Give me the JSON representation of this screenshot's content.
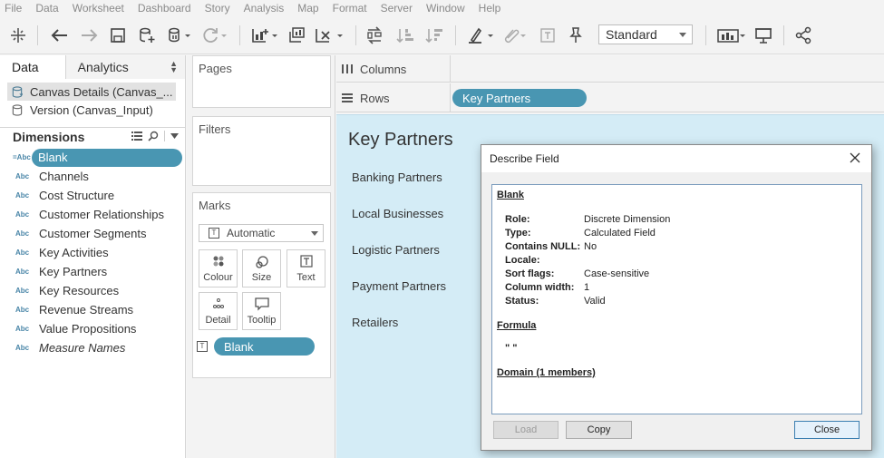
{
  "menu": [
    "File",
    "Data",
    "Worksheet",
    "Dashboard",
    "Story",
    "Analysis",
    "Map",
    "Format",
    "Server",
    "Window",
    "Help"
  ],
  "toolbar": {
    "fit_select": "Standard",
    "icons": [
      "tableau-logo-icon",
      "undo-icon",
      "redo-icon",
      "save-icon",
      "new-datasource-icon",
      "pause-updates-icon",
      "refresh-icon",
      "new-worksheet-icon",
      "duplicate-icon",
      "clear-sheet-icon",
      "swap-icon",
      "sort-ascending-icon",
      "sort-descending-icon",
      "highlight-icon",
      "group-icon",
      "label-icon",
      "pin-icon",
      "show-me-icon",
      "presentation-icon",
      "share-icon"
    ]
  },
  "data_pane": {
    "tabs": [
      "Data",
      "Analytics"
    ],
    "datasources": [
      "Canvas Details (Canvas_...",
      "Version (Canvas_Input)"
    ],
    "dimensions_title": "Dimensions",
    "type_badge": "Abc",
    "selected_type_badge": "=Abc",
    "fields": [
      "Blank",
      "Channels",
      "Cost Structure",
      "Customer Relationships",
      "Customer Segments",
      "Key Activities",
      "Key Partners",
      "Key Resources",
      "Revenue Streams",
      "Value Propositions",
      "Measure Names"
    ]
  },
  "cards": {
    "pages": "Pages",
    "filters": "Filters",
    "marks": "Marks",
    "mark_type": "Automatic",
    "mark_buttons": [
      "Colour",
      "Size",
      "Text",
      "Detail",
      "Tooltip"
    ],
    "marks_pill": "Blank"
  },
  "shelves": {
    "columns": "Columns",
    "rows": "Rows",
    "rows_pill": "Key Partners"
  },
  "viz": {
    "title": "Key Partners",
    "rows": [
      "Banking Partners",
      "Local Businesses",
      "Logistic Partners",
      "Payment Partners",
      "Retailers"
    ]
  },
  "dialog": {
    "title": "Describe Field",
    "field_name": "Blank",
    "props": [
      {
        "k": "Role:",
        "v": "Discrete Dimension"
      },
      {
        "k": "Type:",
        "v": "Calculated Field"
      },
      {
        "k": "Contains NULL:",
        "v": "No"
      },
      {
        "k": "Locale:",
        "v": ""
      },
      {
        "k": "Sort flags:",
        "v": "Case-sensitive"
      },
      {
        "k": "Column width:",
        "v": "1"
      },
      {
        "k": "Status:",
        "v": "Valid"
      }
    ],
    "formula_title": "Formula",
    "formula": "\" \"",
    "domain_title": "Domain (1 members)",
    "buttons": {
      "load": "Load",
      "copy": "Copy",
      "close": "Close"
    }
  }
}
